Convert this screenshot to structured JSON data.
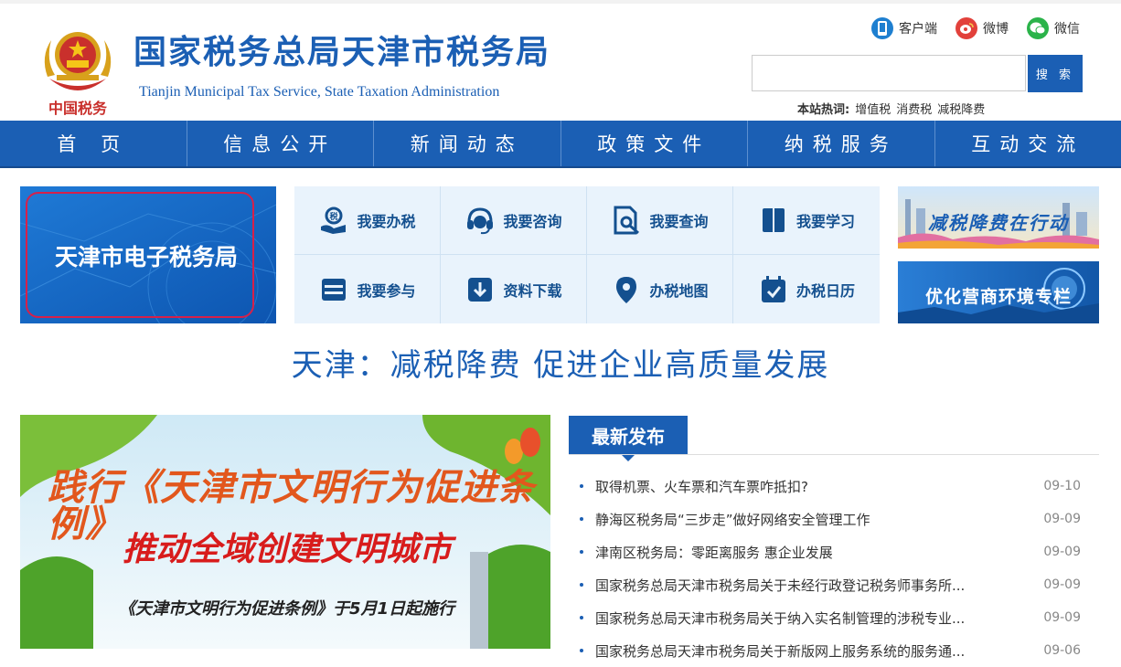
{
  "header": {
    "title": "国家税务总局天津市税务局",
    "subtitle": "Tianjin Municipal Tax Service, State Taxation Administration",
    "emblem_text": "中国税务",
    "quick_links": [
      {
        "label": "客户端",
        "icon": "mobile-client-icon",
        "color": "#1e7fd0"
      },
      {
        "label": "微博",
        "icon": "weibo-icon",
        "color": "#e2413b"
      },
      {
        "label": "微信",
        "icon": "wechat-icon",
        "color": "#2bb34a"
      }
    ],
    "search": {
      "value": "",
      "placeholder": "",
      "button_label": "搜 索"
    },
    "hot": {
      "label": "本站热词:",
      "keywords": [
        "增值税",
        "消费税",
        "减税降费"
      ]
    }
  },
  "nav": {
    "items": [
      "首 页",
      "信息公开",
      "新闻动态",
      "政策文件",
      "纳税服务",
      "互动交流"
    ]
  },
  "etax": {
    "label": "天津市电子税务局"
  },
  "services": [
    {
      "label": "我要办税",
      "icon": "tax-handling-icon"
    },
    {
      "label": "我要咨询",
      "icon": "headset-icon"
    },
    {
      "label": "我要查询",
      "icon": "document-search-icon"
    },
    {
      "label": "我要学习",
      "icon": "book-icon"
    },
    {
      "label": "我要参与",
      "icon": "inbox-icon"
    },
    {
      "label": "资料下载",
      "icon": "download-icon"
    },
    {
      "label": "办税地图",
      "icon": "map-pin-icon"
    },
    {
      "label": "办税日历",
      "icon": "calendar-icon"
    }
  ],
  "banners": [
    {
      "label": "减税降费在行动"
    },
    {
      "label": "优化营商环境专栏"
    }
  ],
  "headline": "天津：减税降费  促进企业高质量发展",
  "promo": {
    "line1": "践行《天津市文明行为促进条例》",
    "line2": "推动全域创建文明城市",
    "line3": "《天津市文明行为促进条例》于5月1日起施行"
  },
  "news": {
    "tab_label": "最新发布",
    "items": [
      {
        "title": "取得机票、火车票和汽车票咋抵扣?",
        "date": "09-10"
      },
      {
        "title": "静海区税务局“三步走”做好网络安全管理工作",
        "date": "09-09"
      },
      {
        "title": "津南区税务局：零距离服务  惠企业发展",
        "date": "09-09"
      },
      {
        "title": "国家税务总局天津市税务局关于未经行政登记税务师事务所...",
        "date": "09-09"
      },
      {
        "title": "国家税务总局天津市税务局关于纳入实名制管理的涉税专业...",
        "date": "09-09"
      },
      {
        "title": "国家税务总局天津市税务局关于新版网上服务系统的服务通...",
        "date": "09-06"
      }
    ]
  },
  "colors": {
    "primary": "#1b5fb4",
    "nav_bg": "#1b5fb4",
    "grid_bg": "#e9f3fc",
    "etax_bg": "#1769c9",
    "accent_red": "#d6204a"
  }
}
